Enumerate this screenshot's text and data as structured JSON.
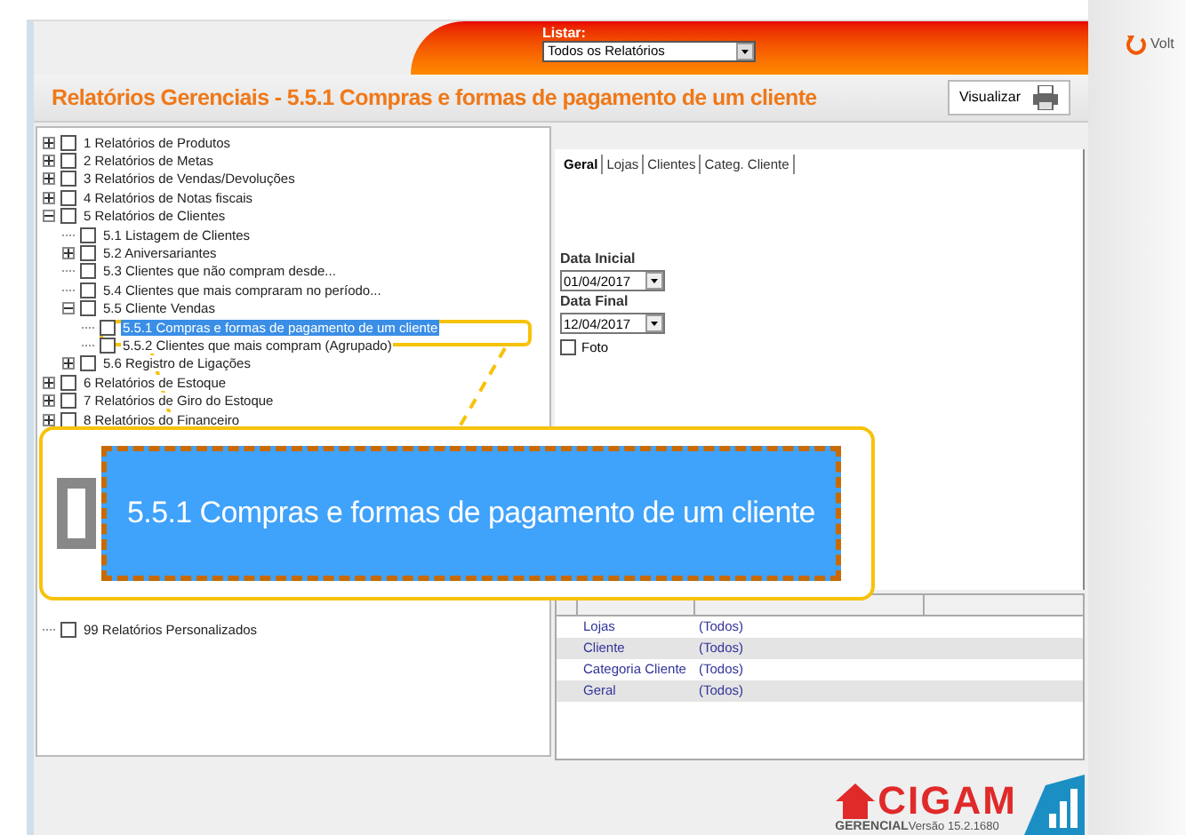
{
  "header": {
    "list_label": "Listar:",
    "list_value": "Todos os Relatórios"
  },
  "back_button": {
    "label": "Volt"
  },
  "title": "Relatórios Gerenciais - 5.5.1 Compras e formas de pagamento de um cliente",
  "preview_button": {
    "label": "Visualizar"
  },
  "tree": [
    {
      "label": "1 Relatórios de Produtos",
      "expanded": false,
      "checked": false,
      "selected": false
    },
    {
      "label": "2 Relatórios de Metas",
      "expanded": false,
      "checked": false,
      "selected": false
    },
    {
      "label": "3 Relatórios de Vendas/Devoluções",
      "expanded": false,
      "checked": false,
      "selected": false
    },
    {
      "label": "4 Relatórios de Notas fiscais",
      "expanded": false,
      "checked": false,
      "selected": false
    },
    {
      "label": "5 Relatórios de Clientes",
      "expanded": true,
      "checked": false,
      "selected": false,
      "children": [
        {
          "label": "5.1 Listagem de Clientes",
          "checked": false,
          "selected": false
        },
        {
          "label": "5.2 Aniversariantes",
          "expanded": false,
          "checked": false,
          "selected": false
        },
        {
          "label": "5.3 Clientes que não compram desde...",
          "checked": false,
          "selected": false
        },
        {
          "label": "5.4 Clientes que mais compraram no período...",
          "checked": false,
          "selected": false
        },
        {
          "label": "5.5 Cliente Vendas",
          "expanded": true,
          "checked": false,
          "selected": false,
          "children": [
            {
              "label": "5.5.1 Compras e formas de pagamento de um cliente",
              "checked": false,
              "selected": true
            },
            {
              "label": "5.5.2 Clientes que mais compram (Agrupado)",
              "checked": false,
              "selected": false
            }
          ]
        },
        {
          "label": "5.6 Registro de Ligações",
          "expanded": false,
          "checked": false,
          "selected": false
        }
      ]
    },
    {
      "label": "6 Relatórios de Estoque",
      "expanded": false,
      "checked": false,
      "selected": false
    },
    {
      "label": "7 Relatórios de Giro do Estoque",
      "expanded": false,
      "checked": false,
      "selected": false
    },
    {
      "label": "8 Relatórios do Financeiro",
      "expanded": false,
      "checked": false,
      "selected": false
    },
    {
      "label": "99 Relatórios Personalizados",
      "checked": false,
      "selected": false
    }
  ],
  "tabs": [
    {
      "label": "Geral",
      "selected": true
    },
    {
      "label": "Lojas",
      "selected": false
    },
    {
      "label": "Clientes",
      "selected": false
    },
    {
      "label": "Categ. Cliente",
      "selected": false
    }
  ],
  "start_date": {
    "label": "Data Inicial",
    "value": "01/04/2017"
  },
  "end_date": {
    "label": "Data Final",
    "value": "12/04/2017"
  },
  "photo": {
    "label": "Foto",
    "checked": false
  },
  "filters": [
    {
      "filter": "Lojas",
      "description": "(Todos)"
    },
    {
      "filter": "Cliente",
      "description": "(Todos)"
    },
    {
      "filter": "Categoria Cliente",
      "description": "(Todos)"
    },
    {
      "filter": "Geral",
      "description": "(Todos)"
    }
  ],
  "magnifier": {
    "text": "5.5.1 Compras e formas de pagamento de um cliente",
    "checked": false
  },
  "logo": {
    "name": "CIGAM",
    "subtitle": "GERENCIAL",
    "version": "Versão 15.2.1680"
  }
}
